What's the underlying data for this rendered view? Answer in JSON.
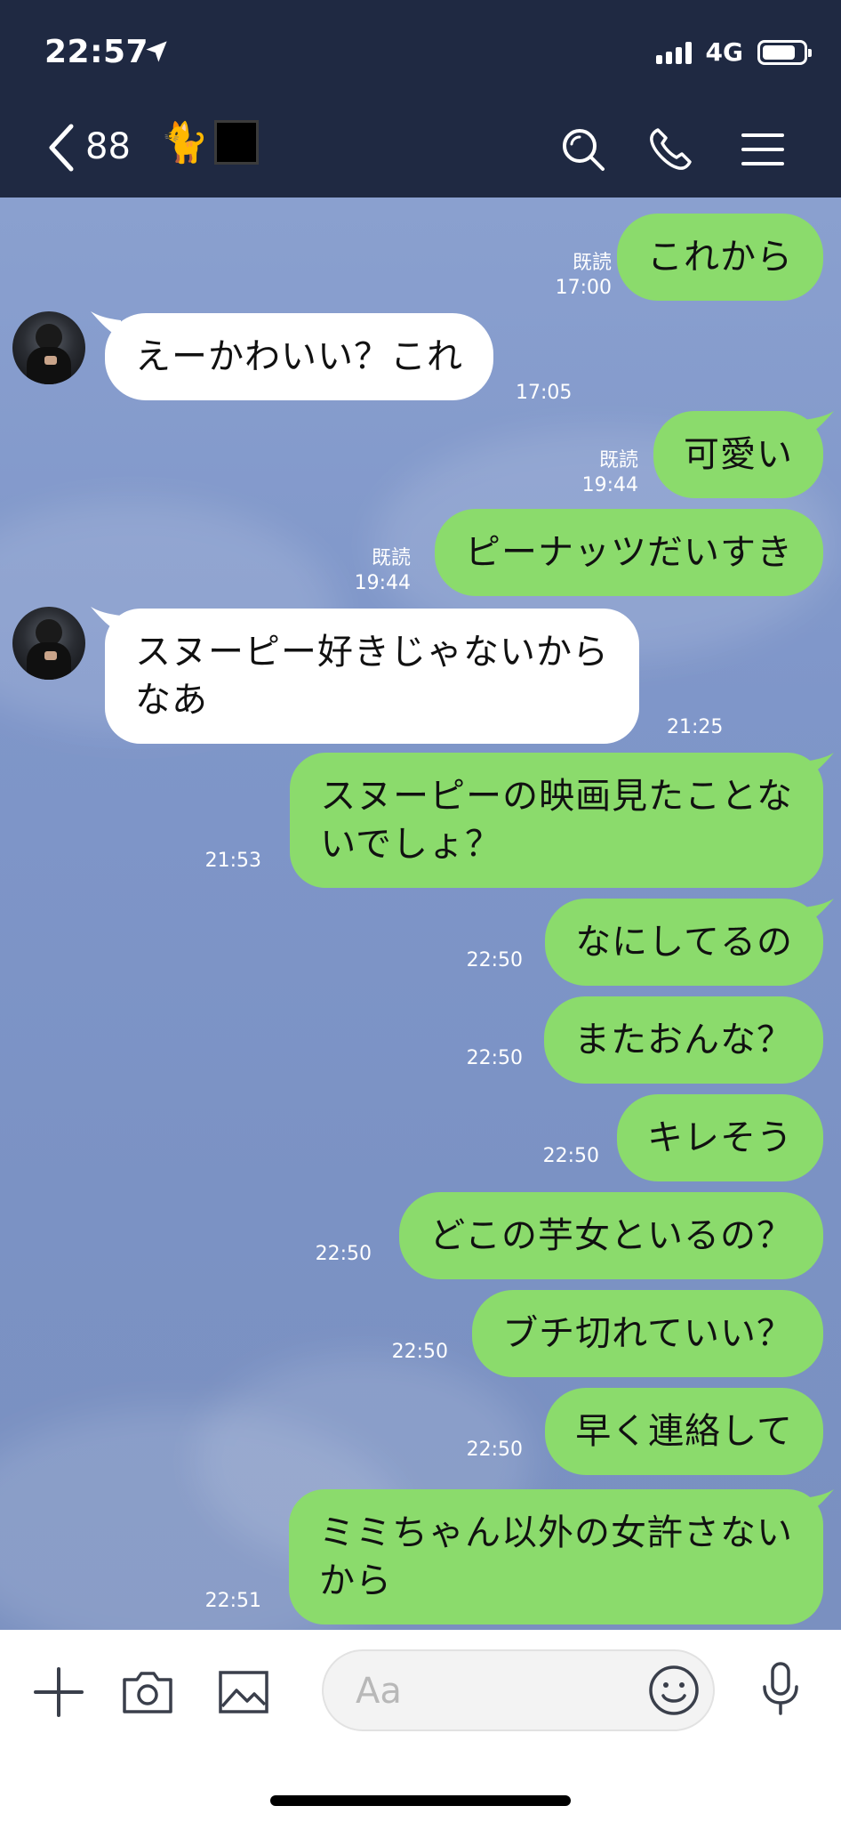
{
  "status": {
    "time": "22:57",
    "network": "4G"
  },
  "header": {
    "back_count": "88",
    "title_emoji": "🐈",
    "colors": {
      "bar": "#1f2942"
    }
  },
  "messages": [
    {
      "side": "out",
      "text": "これから",
      "read": "既読",
      "time": "17:00"
    },
    {
      "side": "in",
      "text": "えーかわいい？これ",
      "time": "17:05"
    },
    {
      "side": "out",
      "text": "可愛い",
      "read": "既読",
      "time": "19:44"
    },
    {
      "side": "out",
      "text": "ピーナッツだいすき",
      "read": "既読",
      "time": "19:44"
    },
    {
      "side": "in",
      "lines": [
        "スヌーピー好きじゃないから",
        "なあ"
      ],
      "time": "21:25"
    },
    {
      "side": "out",
      "lines": [
        "スヌーピーの映画見たことな",
        "いでしょ？"
      ],
      "time": "21:53"
    },
    {
      "side": "out",
      "text": "なにしてるの",
      "time": "22:50"
    },
    {
      "side": "out",
      "text": "またおんな？",
      "time": "22:50"
    },
    {
      "side": "out",
      "text": "キレそう",
      "time": "22:50"
    },
    {
      "side": "out",
      "text": "どこの芋女といるの？",
      "time": "22:50"
    },
    {
      "side": "out",
      "text": "ブチ切れていい？",
      "time": "22:50"
    },
    {
      "side": "out",
      "text": "早く連絡して",
      "time": "22:50"
    },
    {
      "side": "out",
      "lines": [
        "ミミちゃん以外の女許さない",
        "から"
      ],
      "time": "22:51"
    }
  ],
  "input": {
    "placeholder": "Aa"
  },
  "icons": {
    "back": "chevron-left-icon",
    "search": "search-icon",
    "call": "phone-icon",
    "menu": "menu-icon",
    "add": "plus-icon",
    "camera": "camera-icon",
    "image": "image-icon",
    "emoji": "emoji-icon",
    "mic": "microphone-icon"
  },
  "colors": {
    "outgoing_bubble": "#8bdb6c",
    "incoming_bubble": "#ffffff",
    "chat_background": "#7f97c8"
  }
}
